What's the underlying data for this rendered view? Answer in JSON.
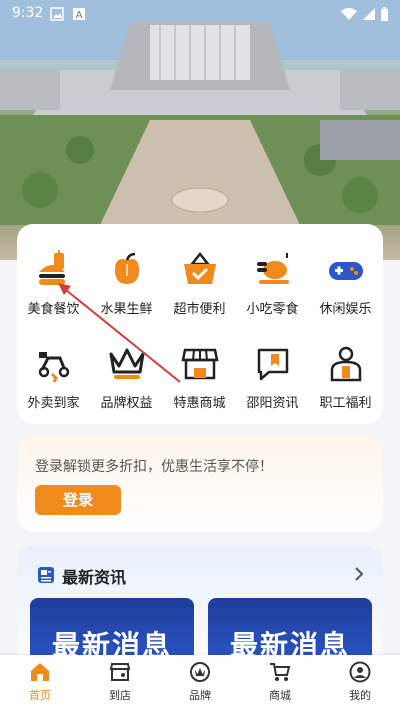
{
  "status_bar": {
    "time": "9:32"
  },
  "categories": [
    {
      "label": "美食餐饮",
      "icon": "burger-drink-icon"
    },
    {
      "label": "水果生鲜",
      "icon": "apple-icon"
    },
    {
      "label": "超市便利",
      "icon": "shopping-basket-icon"
    },
    {
      "label": "小吃零食",
      "icon": "roast-chicken-icon"
    },
    {
      "label": "休闲娱乐",
      "icon": "gamepad-icon"
    },
    {
      "label": "外卖到家",
      "icon": "scooter-icon"
    },
    {
      "label": "品牌权益",
      "icon": "crown-icon"
    },
    {
      "label": "特惠商城",
      "icon": "storefront-icon"
    },
    {
      "label": "邵阳资讯",
      "icon": "bookmark-chat-icon"
    },
    {
      "label": "职工福利",
      "icon": "worker-icon"
    }
  ],
  "login_card": {
    "tip": "登录解锁更多折扣，优惠生活享不停！",
    "button": "登录"
  },
  "news": {
    "title": "最新资讯",
    "items": [
      "最新消息",
      "最新消息"
    ]
  },
  "tabbar": [
    {
      "label": "首页",
      "icon": "home-icon",
      "active": true
    },
    {
      "label": "到店",
      "icon": "store-icon",
      "active": false
    },
    {
      "label": "品牌",
      "icon": "brand-crown-icon",
      "active": false
    },
    {
      "label": "商城",
      "icon": "cart-icon",
      "active": false
    },
    {
      "label": "我的",
      "icon": "user-icon",
      "active": false
    }
  ],
  "colors": {
    "accent": "#f08a1a",
    "icon_dark": "#222222",
    "news_blue": "#2b57c8"
  }
}
